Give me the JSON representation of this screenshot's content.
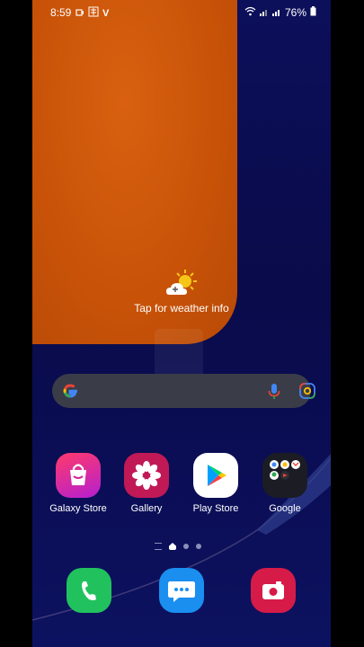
{
  "status_bar": {
    "time": "8:59",
    "battery_percent": "76%",
    "icons": [
      "notification-icon",
      "signal-icon",
      "v-icon",
      "wifi-icon",
      "cell-signal-icon",
      "cell-signal-icon",
      "battery-icon"
    ]
  },
  "weather": {
    "label": "Tap for weather info",
    "icon": "weather-sun-cloud-icon"
  },
  "search": {
    "icons": [
      "google-logo-icon",
      "microphone-icon",
      "lens-icon"
    ]
  },
  "apps": [
    {
      "label": "Galaxy Store",
      "icon": "galaxy-store-icon",
      "color": "#d41f9a"
    },
    {
      "label": "Gallery",
      "icon": "gallery-flower-icon",
      "color": "#c01956"
    },
    {
      "label": "Play Store",
      "icon": "play-store-icon",
      "color": "#ffffff"
    },
    {
      "label": "Google",
      "icon": "google-folder-icon",
      "color": "#1b1c24"
    }
  ],
  "page_indicator": {
    "pages": 3,
    "current": 1
  },
  "dock": [
    {
      "icon": "phone-icon",
      "color": "#21c25e"
    },
    {
      "icon": "messages-icon",
      "color": "#1a8ff0"
    },
    {
      "icon": "camera-icon",
      "color": "#d61b49"
    }
  ],
  "colors": {
    "wallpaper_orange": "#c75208",
    "wallpaper_navy": "#0a0b4a",
    "search_bg": "#3a3d48"
  }
}
